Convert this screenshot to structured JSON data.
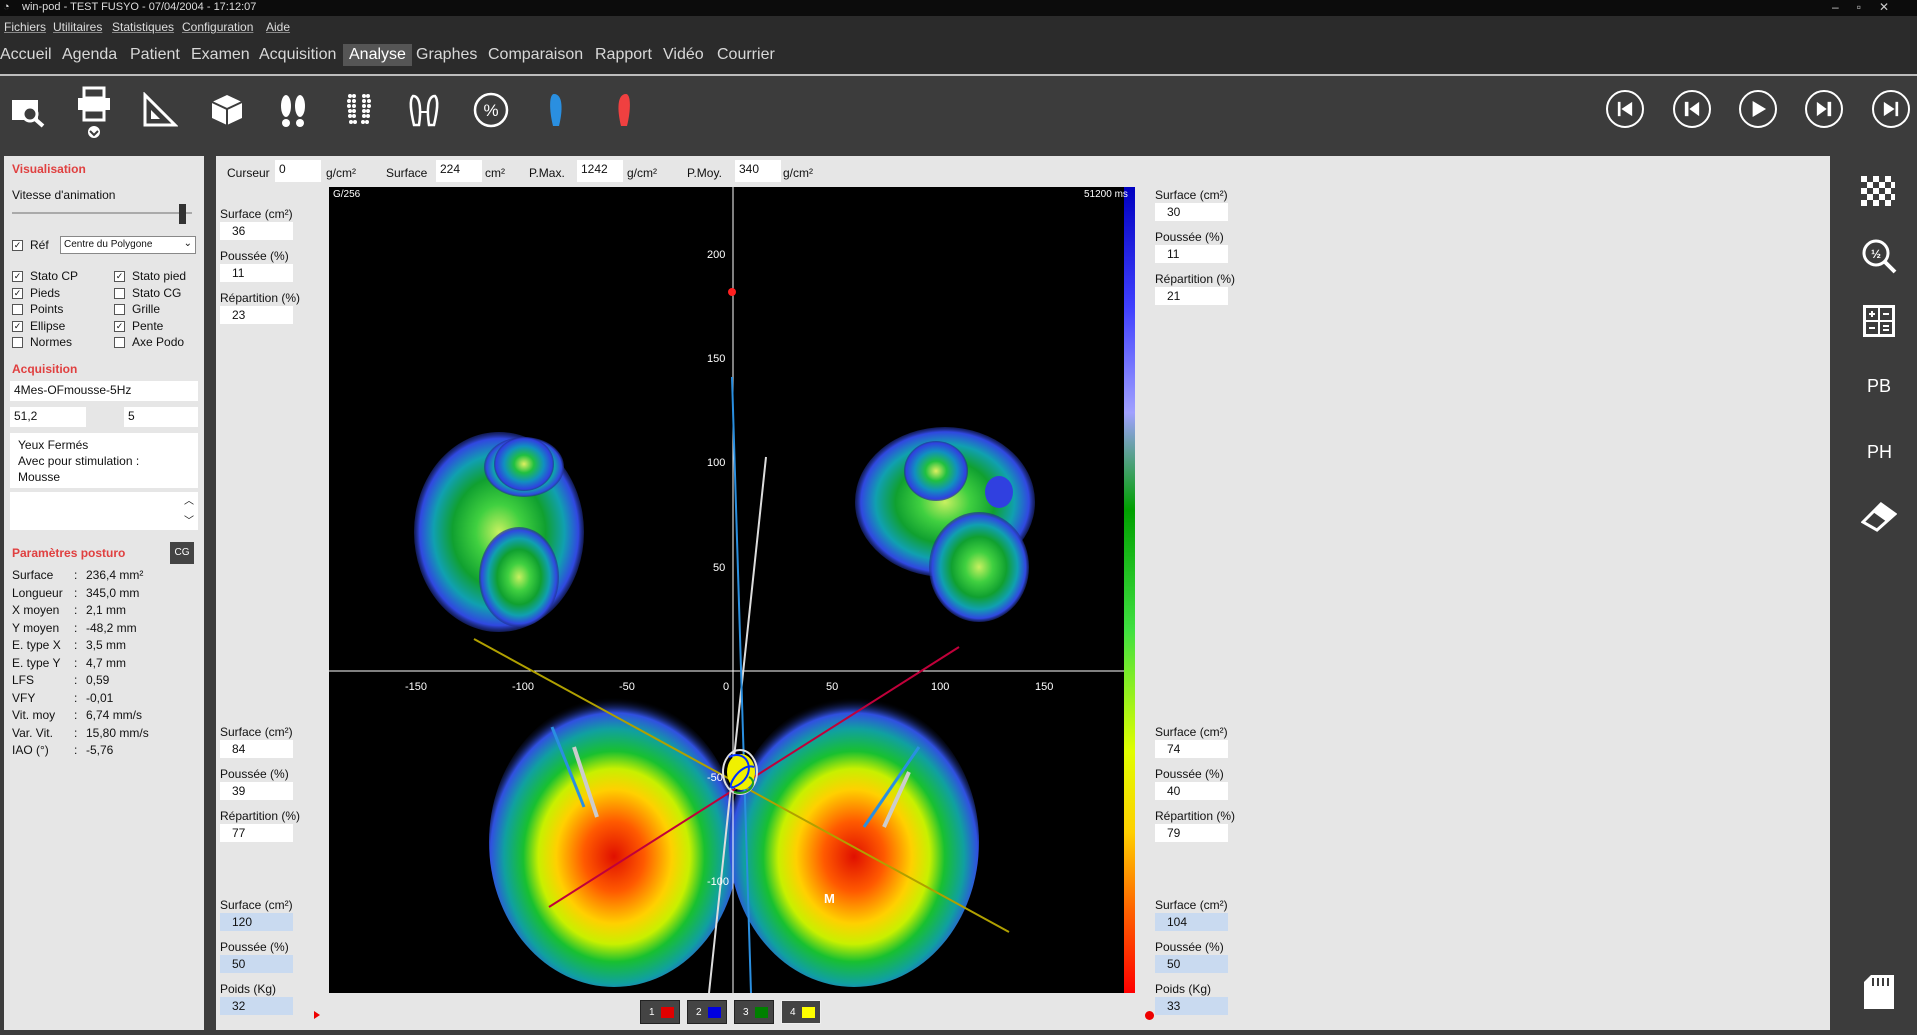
{
  "window": {
    "title": "win-pod - TEST FUSYO - 07/04/2004 - 17:12:07"
  },
  "menu": [
    "Fichiers",
    "Utilitaires",
    "Statistiques",
    "Configuration",
    "Aide"
  ],
  "nav": [
    "Accueil",
    "Agenda",
    "Patient",
    "Examen",
    "Acquisition",
    "Analyse",
    "Graphes",
    "Comparaison",
    "Rapport",
    "Vidéo",
    "Courrier"
  ],
  "nav_active": "Analyse",
  "toolbar_icons": [
    "zoom-search-icon",
    "print-icon",
    "measure-ruler-icon",
    "cube-3d-icon",
    "footprints-icon",
    "dotted-footprints-icon",
    "feet-outline-icon",
    "percent-icon",
    "blue-foot-icon",
    "red-foot-icon"
  ],
  "playback_icons": [
    "skip-start-icon",
    "step-back-icon",
    "play-icon",
    "step-forward-icon",
    "skip-end-icon"
  ],
  "left": {
    "visualisation_title": "Visualisation",
    "animation_label": "Vitesse d'animation",
    "ref_label": "Réf",
    "ref_select": "Centre du Polygone",
    "options": [
      {
        "label": "Stato CP",
        "checked": true
      },
      {
        "label": "Stato pied",
        "checked": true
      },
      {
        "label": "Pieds",
        "checked": true
      },
      {
        "label": "Stato CG",
        "checked": false
      },
      {
        "label": "Points",
        "checked": false
      },
      {
        "label": "Grille",
        "checked": false
      },
      {
        "label": "Ellipse",
        "checked": true
      },
      {
        "label": "Pente",
        "checked": true
      },
      {
        "label": "Normes",
        "checked": false
      },
      {
        "label": "Axe Podo",
        "checked": false
      }
    ],
    "acquisition_title": "Acquisition",
    "acq_name": "4Mes-OFmousse-5Hz",
    "acq_val1": "51,2",
    "acq_val2": "5",
    "notes": [
      "Yeux Fermés",
      "Avec pour stimulation :",
      "Mousse"
    ],
    "posturo_title": "Paramètres posturo",
    "cg_button": "CG",
    "params": [
      {
        "k": "Surface",
        "v": "236,4 mm²"
      },
      {
        "k": "Longueur",
        "v": "345,0 mm"
      },
      {
        "k": "X moyen",
        "v": "2,1 mm"
      },
      {
        "k": "Y moyen",
        "v": "-48,2 mm"
      },
      {
        "k": "E. type X",
        "v": "3,5 mm"
      },
      {
        "k": "E. type Y",
        "v": "4,7 mm"
      },
      {
        "k": "LFS",
        "v": "0,59"
      },
      {
        "k": "VFY",
        "v": "-0,01"
      },
      {
        "k": "Vit. moy",
        "v": "6,74 mm/s"
      },
      {
        "k": "Var. Vit.",
        "v": "15,80 mm/s"
      },
      {
        "k": "IAO (°)",
        "v": "-5,76"
      }
    ]
  },
  "topinfo": {
    "curseur_label": "Curseur",
    "curseur_val": "0",
    "unit1": "g/cm²",
    "surface_label": "Surface",
    "surface_val": "224",
    "unit2": "cm²",
    "pmax_label": "P.Max.",
    "pmax_val": "1242",
    "unit3": "g/cm²",
    "pmoy_label": "P.Moy.",
    "pmoy_val": "340",
    "unit4": "g/cm²"
  },
  "plot": {
    "corner_left": "G/256",
    "corner_right": "51200 ms",
    "x_ticks": [
      "-150",
      "-100",
      "-50",
      "0",
      "50",
      "100",
      "150"
    ],
    "y_ticks": [
      "200",
      "150",
      "100",
      "50",
      "-50",
      "-100"
    ],
    "marker_m": "M",
    "colors": {
      "cold": "#0000c0",
      "mid": "#00c000",
      "warm": "#ffff00",
      "hot": "#ff0000"
    }
  },
  "stats": {
    "left_top": [
      {
        "k": "Surface (cm²)",
        "v": "36"
      },
      {
        "k": "Poussée (%)",
        "v": "11"
      },
      {
        "k": "Répartition (%)",
        "v": "23"
      }
    ],
    "left_mid": [
      {
        "k": "Surface (cm²)",
        "v": "84"
      },
      {
        "k": "Poussée (%)",
        "v": "39"
      },
      {
        "k": "Répartition (%)",
        "v": "77"
      }
    ],
    "left_bot": [
      {
        "k": "Surface (cm²)",
        "v": "120"
      },
      {
        "k": "Poussée (%)",
        "v": "50"
      },
      {
        "k": "Poids (Kg)",
        "v": "32"
      }
    ],
    "right_top": [
      {
        "k": "Surface (cm²)",
        "v": "30"
      },
      {
        "k": "Poussée (%)",
        "v": "11"
      },
      {
        "k": "Répartition (%)",
        "v": "21"
      }
    ],
    "right_mid": [
      {
        "k": "Surface (cm²)",
        "v": "74"
      },
      {
        "k": "Poussée (%)",
        "v": "40"
      },
      {
        "k": "Répartition (%)",
        "v": "79"
      }
    ],
    "right_bot": [
      {
        "k": "Surface (cm²)",
        "v": "104"
      },
      {
        "k": "Poussée (%)",
        "v": "50"
      },
      {
        "k": "Poids (Kg)",
        "v": "33"
      }
    ]
  },
  "legend": [
    {
      "n": "1",
      "color": "#e00000"
    },
    {
      "n": "2",
      "color": "#0000e0"
    },
    {
      "n": "3",
      "color": "#008000"
    },
    {
      "n": "4",
      "color": "#ffff00"
    }
  ],
  "rightbar": {
    "pb": "PB",
    "ph": "PH",
    "icons": [
      "checker-grid-icon",
      "zoom-half-icon",
      "calculator-icon",
      "eraser-icon",
      "sd-card-icon"
    ]
  }
}
